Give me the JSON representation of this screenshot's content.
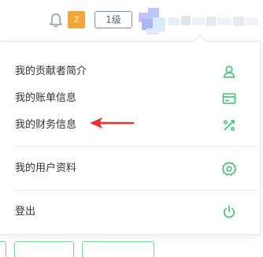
{
  "header": {
    "notification_count": "2",
    "level_label": "1级"
  },
  "menu": {
    "items": [
      {
        "label": "我的贡献者简介",
        "icon": "user-icon"
      },
      {
        "label": "我的账单信息",
        "icon": "billing-card-icon"
      },
      {
        "label": "我的财务信息",
        "icon": "percent-icon"
      },
      {
        "label": "我的用户资料",
        "icon": "gear-icon"
      },
      {
        "label": "登出",
        "icon": "power-icon"
      }
    ]
  },
  "colors": {
    "accent_green": "#3ec26a",
    "badge_orange": "#f0a63a",
    "annotation_red": "#e8322a"
  }
}
